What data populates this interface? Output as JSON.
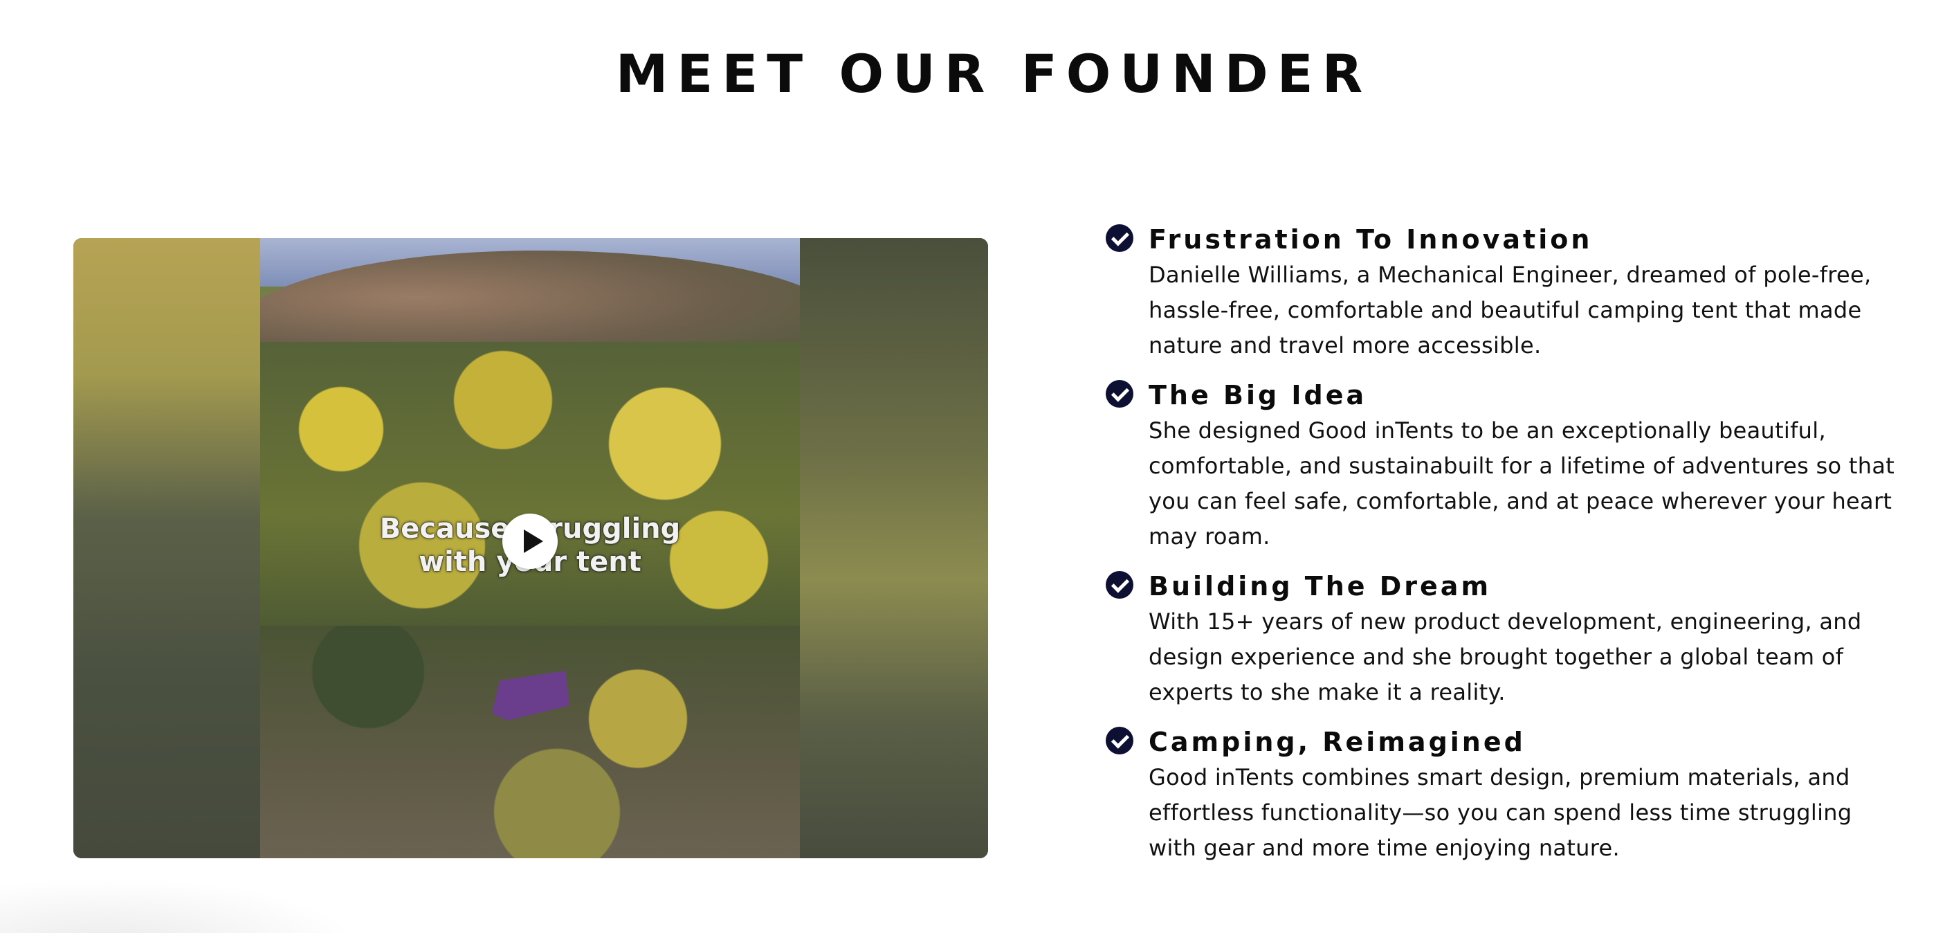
{
  "header": {
    "title": "MEET OUR FOUNDER"
  },
  "video": {
    "caption_line1": "Because struggling",
    "caption_line2": "with your tent",
    "play_icon": "play-icon"
  },
  "features": [
    {
      "icon": "check-circle-icon",
      "title": "Frustration To Innovation",
      "text": "Danielle Williams, a Mechanical Engineer, dreamed of pole-free, hassle-free, comfortable and beautiful camping tent that made nature and travel more accessible."
    },
    {
      "icon": "check-circle-icon",
      "title": "The Big Idea",
      "text": "She designed Good inTents to be an exceptionally beautiful, comfortable, and sustainabuilt for a lifetime of adventures so that you can feel safe, comfortable, and at peace wherever your heart may roam."
    },
    {
      "icon": "check-circle-icon",
      "title": "Building The Dream",
      "text": "With 15+ years of new product development, engineering, and design experience and she brought together a global team of experts to she make it a reality."
    },
    {
      "icon": "check-circle-icon",
      "title": "Camping, Reimagined",
      "text": "Good inTents combines smart design, premium materials, and effortless functionality—so you can spend less time struggling with gear and more time enjoying nature."
    }
  ],
  "colors": {
    "check_bg": "#0d1033",
    "text": "#111111",
    "background": "#ffffff"
  }
}
